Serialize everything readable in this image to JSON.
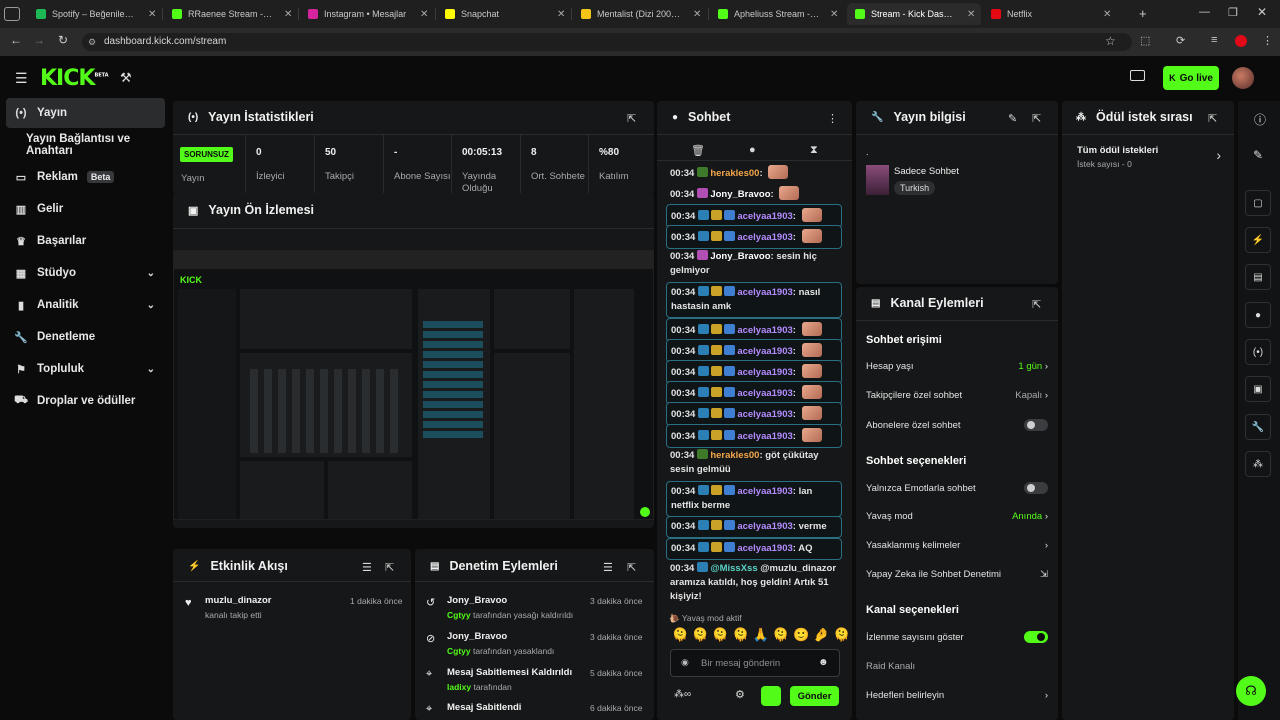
{
  "browser": {
    "tabs": [
      {
        "label": "Spotify – Beğenilen Şarkıl",
        "fav": "#1db954"
      },
      {
        "label": "RRaenee Stream - Watch",
        "fav": "#53fc18"
      },
      {
        "label": "Instagram • Mesajlar",
        "fav": "#d6249f"
      },
      {
        "label": "Snapchat",
        "fav": "#fffc00"
      },
      {
        "label": "Mentalist (Dizi 2008–2015",
        "fav": "#f5c518"
      },
      {
        "label": "Apheliuss Stream - Watc",
        "fav": "#53fc18"
      },
      {
        "label": "Stream - Kick Dashboard",
        "fav": "#53fc18"
      },
      {
        "label": "Netflix",
        "fav": "#e50914"
      }
    ],
    "url": "dashboard.kick.com/stream"
  },
  "app": {
    "logo": "KICK",
    "logo_tag": "BETA",
    "go_live": "Go live"
  },
  "sidebar": {
    "items": [
      {
        "label": "Yayın",
        "icon": "broadcast-icon"
      },
      {
        "label": "Yayın Bağlantısı ve Anahtarı",
        "icon": ""
      },
      {
        "label": "Reklam",
        "icon": "ad-icon",
        "badge": "Beta"
      },
      {
        "label": "Gelir",
        "icon": "revenue-icon"
      },
      {
        "label": "Başarılar",
        "icon": "trophy-icon"
      },
      {
        "label": "Stüdyo",
        "icon": "studio-icon"
      },
      {
        "label": "Analitik",
        "icon": "analytics-icon"
      },
      {
        "label": "Denetleme",
        "icon": "moderation-icon"
      },
      {
        "label": "Topluluk",
        "icon": "community-icon"
      },
      {
        "label": "Droplar ve ödüller",
        "icon": "drops-icon"
      }
    ]
  },
  "stats": {
    "title": "Yayın İstatistikleri",
    "status_badge": "SORUNSUZ",
    "status_label": "Yayın",
    "items": [
      {
        "value": "0",
        "label": "İzleyici"
      },
      {
        "value": "50",
        "label": "Takipçi"
      },
      {
        "value": "-",
        "label": "Abone Sayısı"
      },
      {
        "value": "00:05:13",
        "label": "Yayında Olduğu"
      },
      {
        "value": "8",
        "label": "Ort. Sohbete"
      },
      {
        "value": "%80",
        "label": "Katılım"
      }
    ]
  },
  "preview": {
    "title": "Yayın Ön İzlemesi"
  },
  "activity": {
    "title": "Etkinlik Akışı",
    "items": [
      {
        "name": "muzlu_dinazor",
        "sub": "kanalı takip etti",
        "time": "1 dakika önce"
      }
    ]
  },
  "moderation": {
    "title": "Denetim Eylemleri",
    "items": [
      {
        "name": "Jony_Bravoo",
        "actor": "Cgtyy",
        "sub": "tarafından yasağı kaldırıldı",
        "time": "3 dakika önce"
      },
      {
        "name": "Jony_Bravoo",
        "actor": "Cgtyy",
        "sub": "tarafından yasaklandı",
        "time": "3 dakika önce"
      },
      {
        "name": "Mesaj Sabitlemesi Kaldırıldı",
        "actor": "ladixy",
        "sub": "tarafından",
        "time": "5 dakika önce"
      },
      {
        "name": "Mesaj Sabitlendi",
        "actor": "",
        "sub": "",
        "time": "6 dakika önce"
      }
    ]
  },
  "chat": {
    "title": "Sohbet",
    "messages": [
      {
        "time": "00:34",
        "user": "herakles00",
        "text": "",
        "color": "orange",
        "hl": false
      },
      {
        "time": "00:34",
        "user": "Jony_Bravoo",
        "text": "",
        "color": "white",
        "hl": false
      },
      {
        "time": "00:34",
        "user": "acelyaa1903",
        "text": "",
        "color": "purp",
        "hl": true
      },
      {
        "time": "00:34",
        "user": "acelyaa1903",
        "text": "",
        "color": "purp",
        "hl": true
      },
      {
        "time": "00:34",
        "user": "Jony_Bravoo",
        "text": "sesin hiç gelmiyor",
        "color": "white",
        "hl": false
      },
      {
        "time": "00:34",
        "user": "acelyaa1903",
        "text": "nasıl hastasin amk",
        "color": "purp",
        "hl": true
      },
      {
        "time": "00:34",
        "user": "acelyaa1903",
        "text": "",
        "color": "purp",
        "hl": true
      },
      {
        "time": "00:34",
        "user": "acelyaa1903",
        "text": "",
        "color": "purp",
        "hl": true
      },
      {
        "time": "00:34",
        "user": "acelyaa1903",
        "text": "",
        "color": "purp",
        "hl": true
      },
      {
        "time": "00:34",
        "user": "acelyaa1903",
        "text": "",
        "color": "purp",
        "hl": true
      },
      {
        "time": "00:34",
        "user": "acelyaa1903",
        "text": "",
        "color": "purp",
        "hl": true
      },
      {
        "time": "00:34",
        "user": "acelyaa1903",
        "text": "",
        "color": "purp",
        "hl": true
      },
      {
        "time": "00:34",
        "user": "herakles00",
        "text": "göt çükütay sesin gelmüü",
        "color": "orange",
        "hl": false
      },
      {
        "time": "00:34",
        "user": "acelyaa1903",
        "text": "lan netflix berme",
        "color": "purp",
        "hl": true
      },
      {
        "time": "00:34",
        "user": "acelyaa1903",
        "text": "verme",
        "color": "purp",
        "hl": true
      },
      {
        "time": "00:34",
        "user": "acelyaa1903",
        "text": "AQ",
        "color": "purp",
        "hl": true
      },
      {
        "time": "00:34",
        "user": "@MissXss",
        "text": "@muzlu_dinazor aramıza katıldı, hoş geldin! Artık 51 kişiyiz!",
        "color": "teal",
        "hl": false
      }
    ],
    "slow_mode": "Yavaş mod aktif",
    "input_placeholder": "Bir mesaj gönderin",
    "send": "Gönder"
  },
  "stream_info": {
    "title": "Yayın bilgisi",
    "dot": ".",
    "category": "Sadece Sohbet",
    "tag": "Turkish"
  },
  "rewards": {
    "title": "Ödül istek sırası",
    "all_label": "Tüm ödül istekleri",
    "count_label": "İstek sayısı - 0"
  },
  "channel_actions": {
    "title": "Kanal Eylemleri",
    "chat_access": "Sohbet erişimi",
    "account_age": {
      "label": "Hesap yaşı",
      "value": "1 gün"
    },
    "followers_only": {
      "label": "Takipçilere özel sohbet",
      "value": "Kapalı"
    },
    "subs_only": {
      "label": "Abonelere özel sohbet"
    },
    "chat_options": "Sohbet seçenekleri",
    "emote_only": {
      "label": "Yalnızca Emotlarla sohbet"
    },
    "slow_mode": {
      "label": "Yavaş mod",
      "value": "Anında"
    },
    "banned_words": {
      "label": "Yasaklanmış kelimeler"
    },
    "ai_moderation": {
      "label": "Yapay Zeka ile Sohbet Denetimi"
    },
    "channel_options": "Kanal seçenekleri",
    "show_viewers": {
      "label": "İzlenme sayısını göster"
    },
    "raid": {
      "label": "Raid Kanalı"
    },
    "goals": {
      "label": "Hedefleri belirleyin"
    }
  },
  "colors": {
    "accent": "#53fc18",
    "panel": "#161718",
    "bg": "#0b0b0c"
  }
}
